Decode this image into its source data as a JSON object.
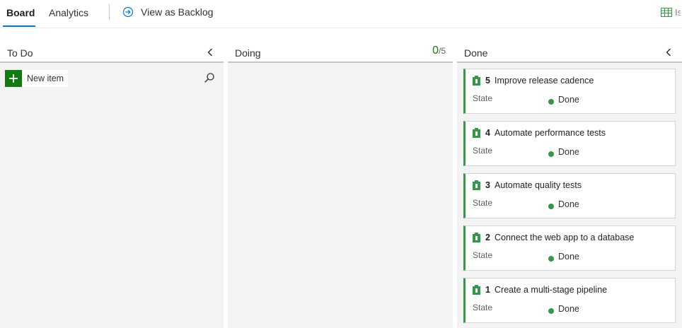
{
  "tabs": [
    {
      "label": "Board",
      "active": true
    },
    {
      "label": "Analytics",
      "active": false
    }
  ],
  "view_backlog": {
    "label": "View as Backlog",
    "icon": "arrow-circle-right-icon"
  },
  "settings": {
    "label": "Is",
    "icon": "board-settings-icon"
  },
  "colors": {
    "accent": "#0078d4",
    "done_green": "#339947",
    "add_green": "#107c10"
  },
  "columns": [
    {
      "title": "To Do",
      "new_item_label": "New item",
      "cards": []
    },
    {
      "title": "Doing",
      "wip_count": "0",
      "wip_limit": "/5",
      "cards": []
    },
    {
      "title": "Done",
      "cards": [
        {
          "id": "5",
          "title": "Improve release cadence",
          "field_label": "State",
          "state": "Done"
        },
        {
          "id": "4",
          "title": "Automate performance tests",
          "field_label": "State",
          "state": "Done"
        },
        {
          "id": "3",
          "title": "Automate quality tests",
          "field_label": "State",
          "state": "Done"
        },
        {
          "id": "2",
          "title": "Connect the web app to a database",
          "field_label": "State",
          "state": "Done"
        },
        {
          "id": "1",
          "title": "Create a multi-stage pipeline",
          "field_label": "State",
          "state": "Done"
        }
      ]
    }
  ]
}
